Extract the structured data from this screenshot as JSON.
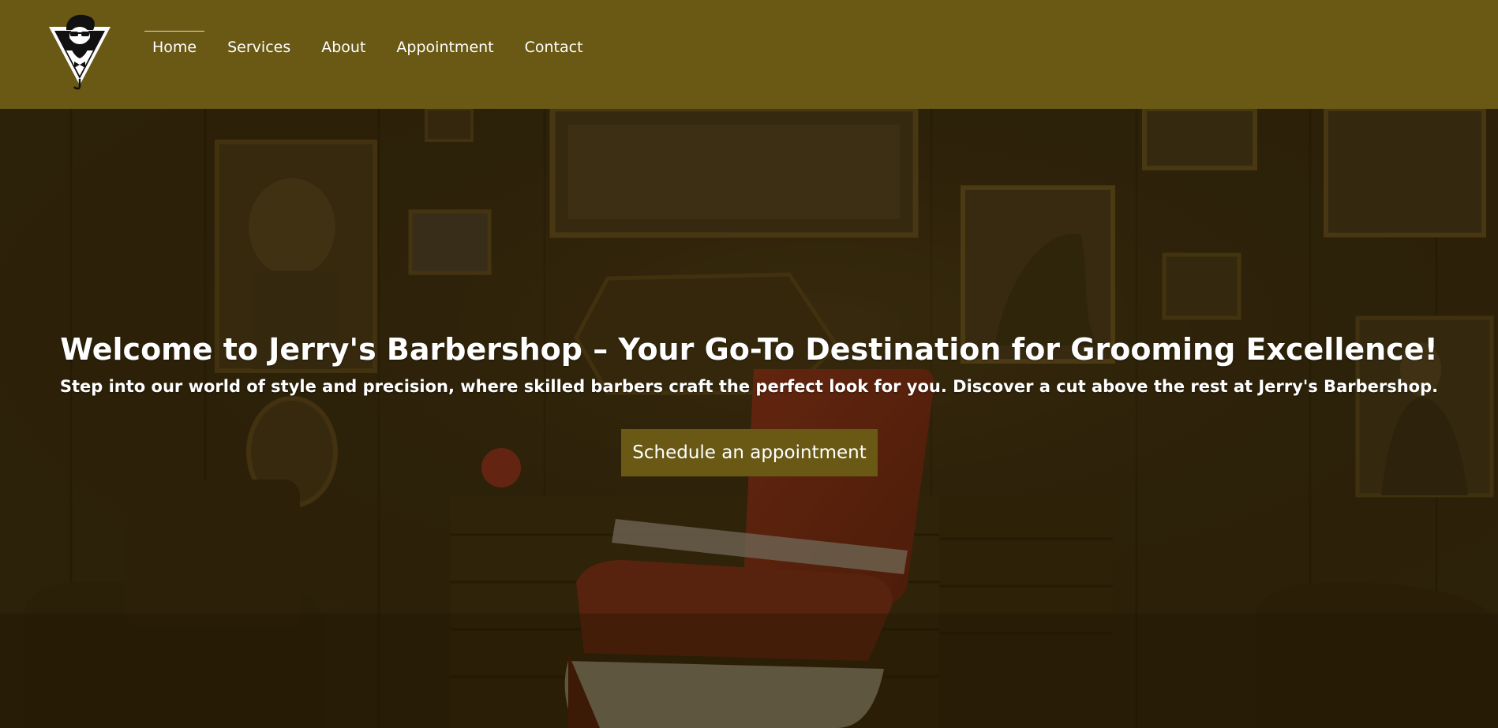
{
  "nav": {
    "logo_icon": "bearded-man-triangle-logo",
    "links": [
      {
        "label": "Home",
        "active": true
      },
      {
        "label": "Services"
      },
      {
        "label": "About"
      },
      {
        "label": "Appointment"
      },
      {
        "label": "Contact"
      }
    ]
  },
  "hero": {
    "title": "Welcome to Jerry's Barbershop – Your Go-To Destination for Grooming Excellence!",
    "subtitle": "Step into our world of style and precision, where skilled barbers craft the perfect look for you. Discover a cut above the rest at Jerry's Barbershop.",
    "cta_label": "Schedule an appointment",
    "background_image": "barbershop-interior-with-red-barber-chair"
  },
  "colors": {
    "brand": "#695915",
    "hero_overlay": "#2a1f0c",
    "text": "#ffffff"
  }
}
